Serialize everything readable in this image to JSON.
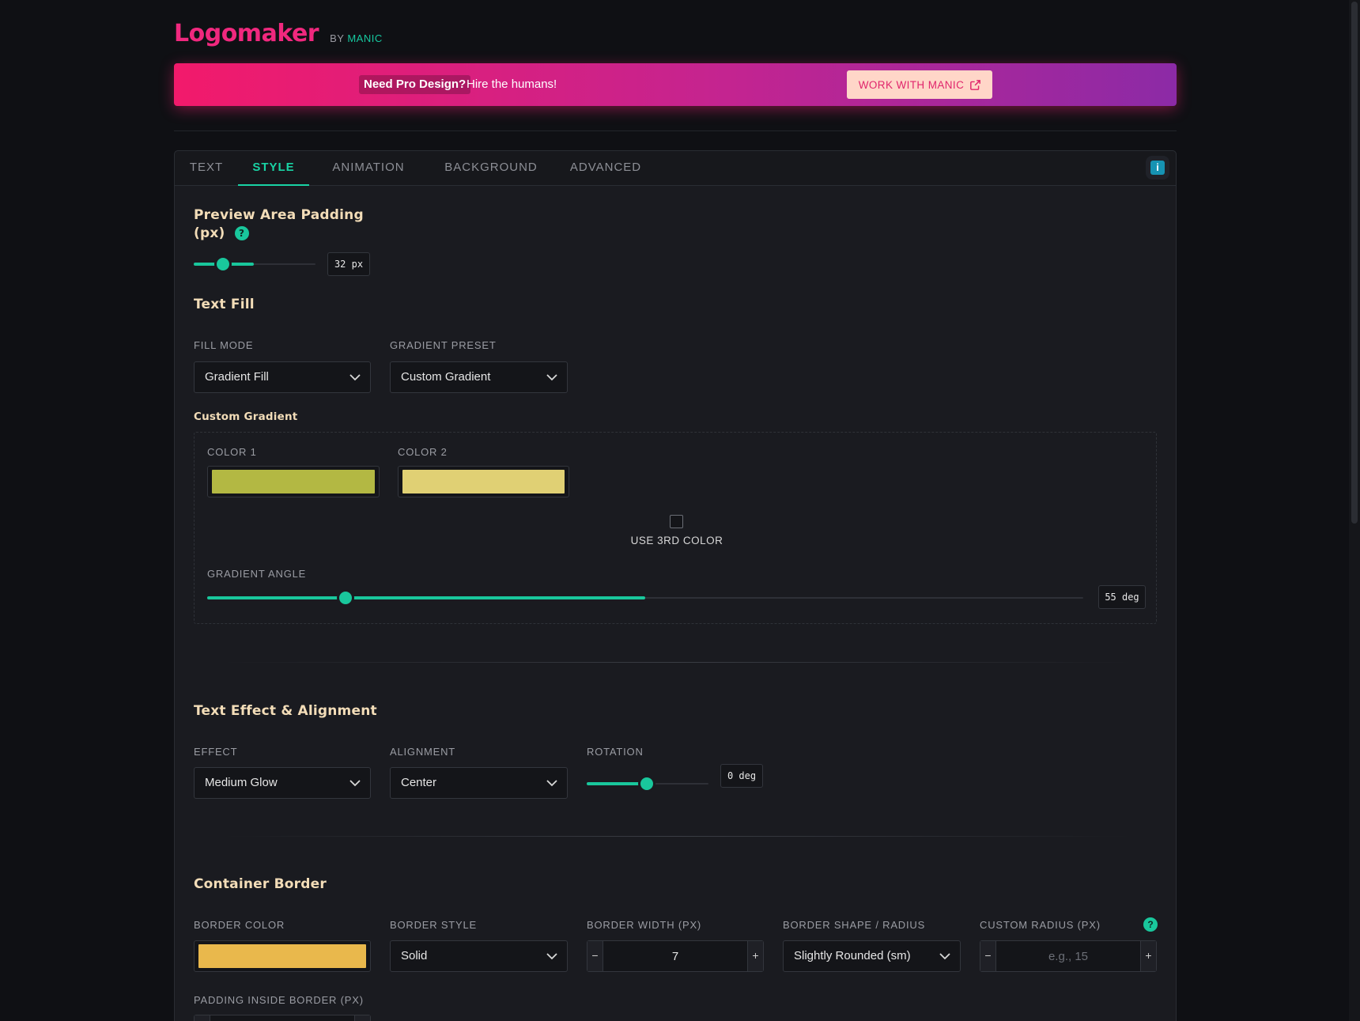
{
  "header": {
    "logo": "Logomaker",
    "by_label": "BY",
    "by_brand": "MANIC"
  },
  "banner": {
    "highlight": "Need Pro Design?",
    "subtext": "Hire the humans!",
    "cta_label": "WORK WITH MANIC",
    "cta_icon": "external-link-icon"
  },
  "tabs": [
    {
      "label": "TEXT",
      "active": false
    },
    {
      "label": "STYLE",
      "active": true
    },
    {
      "label": "ANIMATION",
      "active": false
    },
    {
      "label": "BACKGROUND",
      "active": false
    },
    {
      "label": "ADVANCED",
      "active": false
    }
  ],
  "info_button": {
    "label": "i"
  },
  "padding_section": {
    "title_line1": "Preview Area Padding",
    "title_line2": "(px)",
    "help": "?",
    "value": 32,
    "value_text": "32 px"
  },
  "text_fill": {
    "title": "Text Fill",
    "fill_mode_label": "FILL MODE",
    "fill_mode_value": "Gradient Fill",
    "preset_label": "GRADIENT PRESET",
    "preset_value": "Custom Gradient",
    "custom_title": "Custom Gradient",
    "color1_label": "COLOR 1",
    "color1": "#b3b843",
    "color2_label": "COLOR 2",
    "color2": "#e0d074",
    "third_color_label": "USE 3RD COLOR",
    "third_color_checked": false,
    "angle_label": "GRADIENT ANGLE",
    "angle_value": 55,
    "angle_text": "55 deg"
  },
  "text_effect": {
    "title": "Text Effect & Alignment",
    "effect_label": "EFFECT",
    "effect_value": "Medium Glow",
    "alignment_label": "ALIGNMENT",
    "alignment_value": "Center",
    "rotation_label": "ROTATION",
    "rotation_value": 0,
    "rotation_text": "0 deg"
  },
  "container_border": {
    "title": "Container Border",
    "color_label": "BORDER COLOR",
    "color": "#e9b84c",
    "style_label": "BORDER STYLE",
    "style_value": "Solid",
    "width_label": "BORDER WIDTH (PX)",
    "width_value": "7",
    "shape_label": "BORDER SHAPE / RADIUS",
    "shape_value": "Slightly Rounded (sm)",
    "radius_label": "CUSTOM RADIUS (PX)",
    "radius_placeholder": "e.g., 15",
    "radius_help": "?",
    "padding_label": "PADDING INSIDE BORDER (PX)"
  },
  "colors": {
    "accent": "#19c79c",
    "brand_pink": "#f0287e"
  }
}
